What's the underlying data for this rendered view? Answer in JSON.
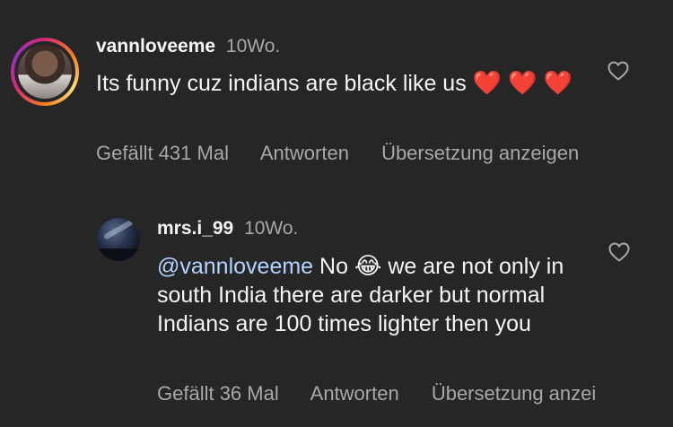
{
  "comments": [
    {
      "username": "vannloveeme",
      "time": "10Wo.",
      "text": "Its funny cuz indians are black like us",
      "emoji_after": "❤️ ❤️ ❤️",
      "likes": "Gefällt 431 Mal",
      "reply": "Antworten",
      "translate": "Übersetzung anzeigen"
    },
    {
      "username": "mrs.i_99",
      "time": "10Wo.",
      "mention": "@vannloveeme",
      "text_a": "No",
      "emoji": "😂",
      "text_b": "we are not only in south India there are darker but normal Indians are 100 times lighter then you",
      "likes": "Gefällt 36 Mal",
      "reply": "Antworten",
      "translate": "Übersetzung anzei"
    }
  ],
  "icons": {
    "like": "heart-outline-icon"
  },
  "colors": {
    "background": "#262626",
    "primary_text": "#f5f5f5",
    "secondary_text": "#a8a8a8",
    "mention": "#b3d4ff",
    "heart_emoji": "#e8312f"
  }
}
